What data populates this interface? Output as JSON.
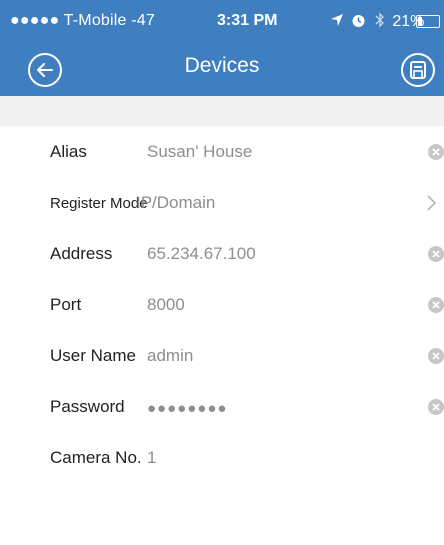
{
  "statusbar": {
    "carrier": "●●●●● T-Mobile -47",
    "time": "3:31 PM",
    "battery_text": "21%",
    "battery_level": 0.21,
    "icons": [
      "location-icon",
      "alarm-icon",
      "bluetooth-icon",
      "battery-icon"
    ]
  },
  "navbar": {
    "title": "Devices",
    "back_icon": "back-arrow-icon",
    "save_icon": "save-icon"
  },
  "form": {
    "rows": [
      {
        "label": "Alias",
        "value": "Susan' House",
        "accessory": "clear-icon"
      },
      {
        "label": "Register Mode",
        "value": "IP/Domain",
        "accessory": "chevron-right-icon"
      },
      {
        "label": "Address",
        "value": "65.234.67.100",
        "accessory": "clear-icon"
      },
      {
        "label": "Port",
        "value": "8000",
        "accessory": "clear-icon"
      },
      {
        "label": "User Name",
        "value": "admin",
        "accessory": "clear-icon"
      },
      {
        "label": "Password",
        "value": "●●●●●●●●",
        "accessory": "clear-icon"
      },
      {
        "label": "Camera No.",
        "value": "1",
        "accessory": ""
      }
    ]
  },
  "colors": {
    "header": "#3f7fc0",
    "gap": "#f1f1f1",
    "label": "#222222",
    "value": "#8e8e8e",
    "clear_icon": "#c7c7c7"
  }
}
